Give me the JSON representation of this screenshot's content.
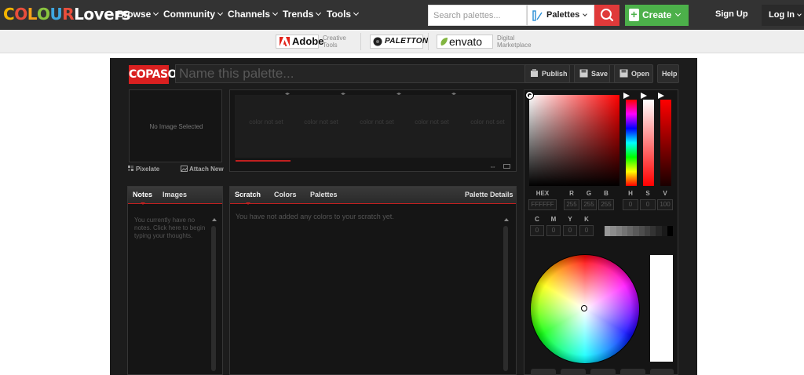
{
  "nav": {
    "logo": {
      "letters": [
        "C",
        "O",
        "L",
        "O",
        "U",
        "R",
        "L",
        "o",
        "v",
        "e",
        "r",
        "s"
      ],
      "colors": [
        "#f4b400",
        "#e94e3c",
        "#f7a11a",
        "#8ac43f",
        "#3fa7e0",
        "#e94e3c",
        "#ffffff",
        "#ffffff",
        "#ffffff",
        "#ffffff",
        "#ffffff",
        "#ffffff"
      ]
    },
    "items": [
      "Browse",
      "Community",
      "Channels",
      "Trends",
      "Tools"
    ],
    "search_placeholder": "Search palettes...",
    "search_type": "Palettes",
    "create_label": "Create",
    "signup_label": "Sign Up",
    "login_label": "Log In",
    "accent_red": "#e03a3a",
    "accent_green": "#4cb04a"
  },
  "partners": [
    {
      "name": "Adobe",
      "tagline_1": "Creative",
      "tagline_2": "Tools"
    },
    {
      "name": "PALETTON"
    },
    {
      "name": "envato",
      "tagline_1": "Digital",
      "tagline_2": "Marketplace"
    }
  ],
  "app": {
    "brand": "COPASO",
    "name_placeholder": "Name this palette...",
    "toolbar": {
      "publish": "Publish",
      "save": "Save",
      "open": "Open",
      "help": "Help"
    },
    "image_panel": {
      "empty_text": "No Image Selected",
      "pixelate": "Pixelate",
      "attach": "Attach New"
    },
    "swatches": [
      "color not set",
      "color not set",
      "color not set",
      "color not set",
      "color not set"
    ],
    "notes_tabs": {
      "notes": "Notes",
      "images": "Images"
    },
    "notes_text": "You currently have no notes. Click here to begin typing your thoughts.",
    "scratch_tabs": {
      "scratch": "Scratch",
      "colors": "Colors",
      "palettes": "Palettes",
      "details": "Palette Details"
    },
    "scratch_empty": "You have not added any colors to your scratch yet.",
    "picker": {
      "labels": {
        "hex": "HEX",
        "r": "R",
        "g": "G",
        "b": "B",
        "h": "H",
        "s": "S",
        "v": "V",
        "c": "C",
        "m": "M",
        "y": "Y",
        "k": "K"
      },
      "hex": "FFFFFF",
      "r": "255",
      "g": "255",
      "b": "255",
      "h": "0",
      "s": "0",
      "v": "100",
      "c": "0",
      "m": "0",
      "y": "0",
      "k": "0",
      "gray_steps": [
        "#999999",
        "#8c8c8c",
        "#808080",
        "#737373",
        "#666666",
        "#595959",
        "#4d4d4d",
        "#404040",
        "#333333",
        "#262626",
        "#1a1a1a",
        "#000000"
      ]
    }
  }
}
